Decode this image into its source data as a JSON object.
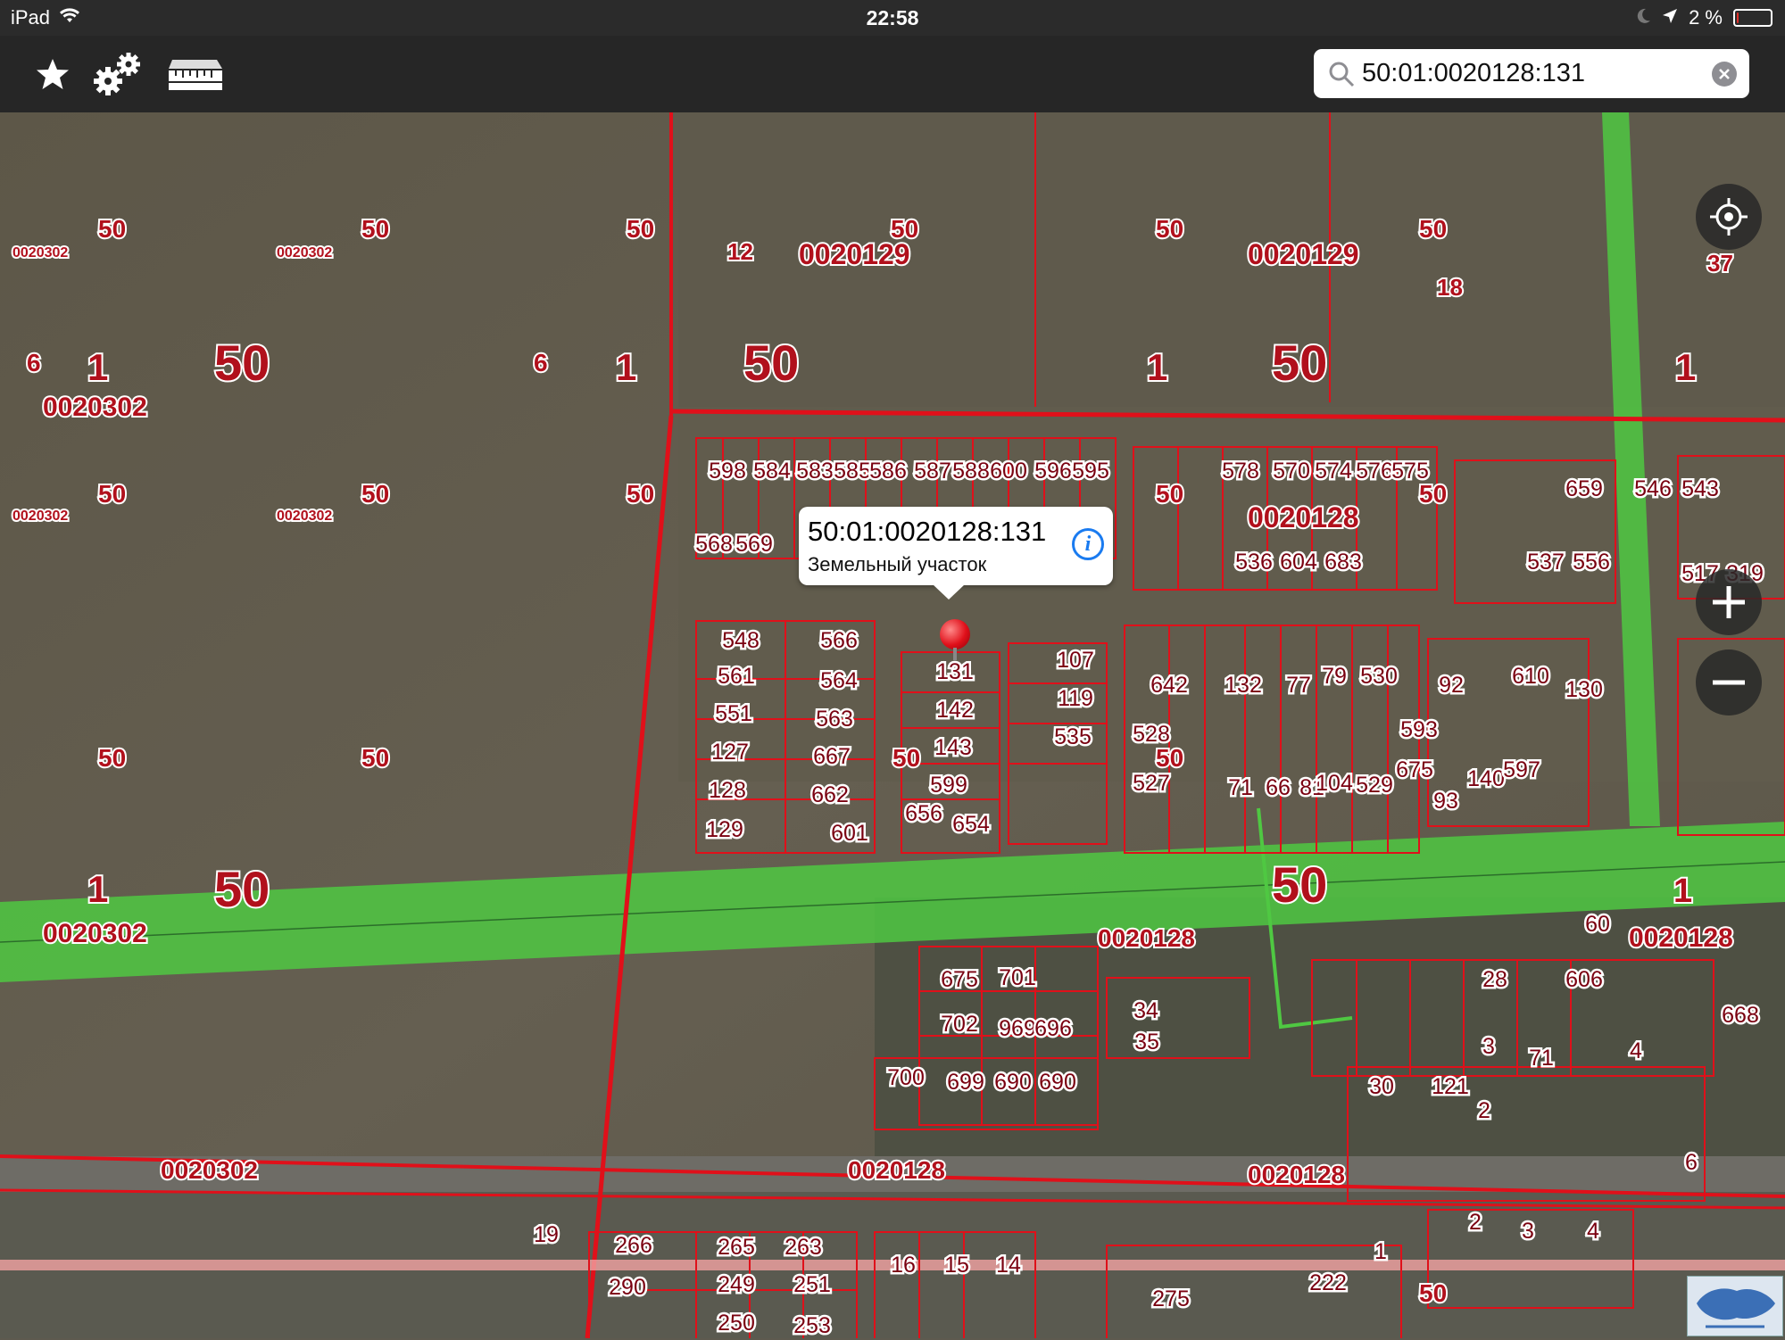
{
  "status_bar": {
    "device": "iPad",
    "time": "22:58",
    "battery": "2 %",
    "battery_level": 0.02
  },
  "toolbar": {
    "favorites_icon": "star-icon",
    "settings_icon": "gears-icon",
    "ruler_icon": "ruler-icon"
  },
  "search": {
    "value": "50:01:0020128:131",
    "icon": "search-icon",
    "clear_icon": "clear-icon"
  },
  "callout": {
    "title": "50:01:0020128:131",
    "subtitle": "Земельный участок",
    "info_icon": "info-icon"
  },
  "map": {
    "controls": {
      "locate": "locate-icon",
      "zoom_in": "+",
      "zoom_out": "−"
    },
    "district_labels": [
      {
        "text": "0020302"
      },
      {
        "text": "0020302"
      },
      {
        "text": "0020129"
      },
      {
        "text": "0020129"
      },
      {
        "text": "0020128"
      },
      {
        "text": "0020128"
      },
      {
        "text": "0020302"
      },
      {
        "text": "0020128"
      },
      {
        "text": "0020128"
      },
      {
        "text": "0020128"
      },
      {
        "text": "0020302"
      },
      {
        "text": "0020302"
      },
      {
        "text": "0020302"
      },
      {
        "text": "0020302"
      }
    ],
    "big_labels": [
      {
        "text": "50"
      },
      {
        "text": "50"
      },
      {
        "text": "50"
      },
      {
        "text": "50"
      },
      {
        "text": "50"
      },
      {
        "text": "1"
      },
      {
        "text": "1"
      },
      {
        "text": "1"
      },
      {
        "text": "1"
      },
      {
        "text": "1"
      },
      {
        "text": "6"
      },
      {
        "text": "6"
      },
      {
        "text": "12"
      },
      {
        "text": "18"
      },
      {
        "text": "37"
      },
      {
        "text": "1"
      }
    ],
    "small_labels": [
      {
        "text": "50"
      },
      {
        "text": "50"
      },
      {
        "text": "50"
      },
      {
        "text": "50"
      },
      {
        "text": "50"
      },
      {
        "text": "50"
      },
      {
        "text": "50"
      },
      {
        "text": "50"
      },
      {
        "text": "50"
      },
      {
        "text": "50"
      },
      {
        "text": "50"
      },
      {
        "text": "50"
      },
      {
        "text": "50"
      },
      {
        "text": "50"
      },
      {
        "text": "50"
      },
      {
        "text": "50"
      }
    ],
    "plots": [
      "548",
      "566",
      "131",
      "107",
      "561",
      "564",
      "142",
      "119",
      "551",
      "563",
      "143",
      "535",
      "127",
      "667",
      "599",
      "128",
      "662",
      "656",
      "129",
      "601",
      "654",
      "598",
      "584",
      "583",
      "585",
      "586",
      "587",
      "588",
      "600",
      "596",
      "595",
      "568",
      "569",
      "578",
      "570",
      "574",
      "576",
      "575",
      "536",
      "604",
      "683",
      "537",
      "556",
      "642",
      "132",
      "77",
      "79",
      "530",
      "92",
      "610",
      "130",
      "528",
      "593",
      "527",
      "71",
      "66",
      "81",
      "104",
      "529",
      "675",
      "93",
      "140",
      "597",
      "675",
      "701",
      "702",
      "969",
      "696",
      "700",
      "699",
      "690",
      "690",
      "34",
      "35",
      "28",
      "606",
      "60",
      "30",
      "121",
      "2",
      "3",
      "71",
      "4",
      "266",
      "265",
      "263",
      "290",
      "249",
      "251",
      "250",
      "253",
      "16",
      "15",
      "14",
      "2",
      "3",
      "4",
      "1",
      "222",
      "275",
      "19",
      "668",
      "659",
      "546",
      "543",
      "517",
      "319",
      "6"
    ]
  }
}
